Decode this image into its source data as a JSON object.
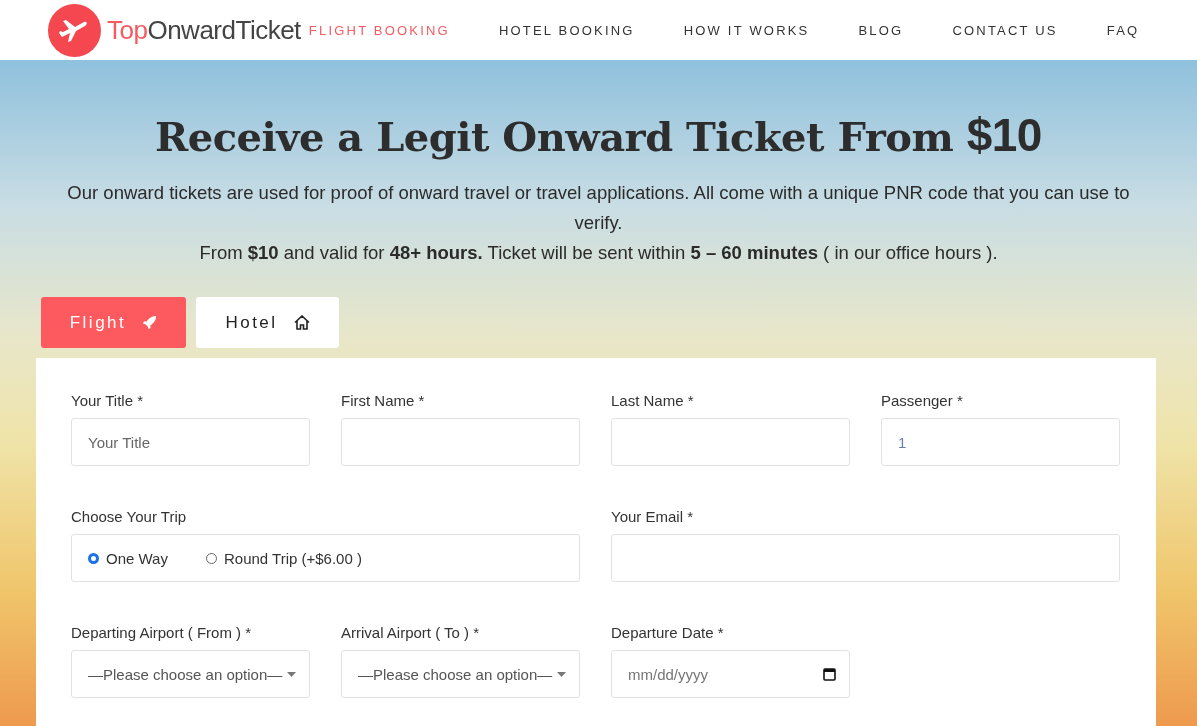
{
  "logo": {
    "accent": "Top",
    "rest": "OnwardTicket"
  },
  "nav": [
    {
      "label": "FLIGHT BOOKING",
      "selected": true
    },
    {
      "label": "HOTEL BOOKING",
      "selected": false
    },
    {
      "label": "HOW IT WORKS",
      "selected": false
    },
    {
      "label": "BLOG",
      "selected": false
    },
    {
      "label": "CONTACT US",
      "selected": false
    },
    {
      "label": "FAQ",
      "selected": false
    }
  ],
  "hero": {
    "title": "Receive a Legit Onward Ticket From",
    "price": "$10",
    "description": "Our onward tickets are used for proof of onward travel or travel applications. All come with a unique PNR code that you can use to verify.",
    "details": "From **$10** and valid for **48+ hours.** Ticket will be sent within **5 – 60 minutes** ( in our office hours )."
  },
  "tabs": [
    {
      "label": "Flight",
      "selected": true,
      "kind": "rocket"
    },
    {
      "label": "Hotel",
      "selected": false,
      "kind": "home"
    }
  ],
  "fields": [
    {
      "kind": "text",
      "label": "Your Title *",
      "placeholder": "Your Title"
    },
    {
      "kind": "text",
      "label": "First Name *"
    },
    {
      "kind": "text",
      "label": "Last Name *"
    },
    {
      "kind": "number",
      "label": "Passenger *",
      "value": "1"
    },
    {
      "kind": "trip",
      "label": "Choose Your Trip",
      "options": [
        {
          "label": "One Way",
          "selected": true
        },
        {
          "label": "Round Trip (+$6.00 )",
          "selected": false
        }
      ]
    },
    {
      "kind": "email",
      "label": "Your Email *"
    },
    {
      "kind": "select",
      "label": "Departing Airport ( From ) *",
      "value": "—Please choose an option—"
    },
    {
      "kind": "select",
      "label": "Arrival Airport ( To ) *",
      "value": "—Please choose an option—"
    },
    {
      "kind": "date",
      "label": "Departure Date *",
      "placeholder": "mm/dd/yyyy"
    }
  ]
}
